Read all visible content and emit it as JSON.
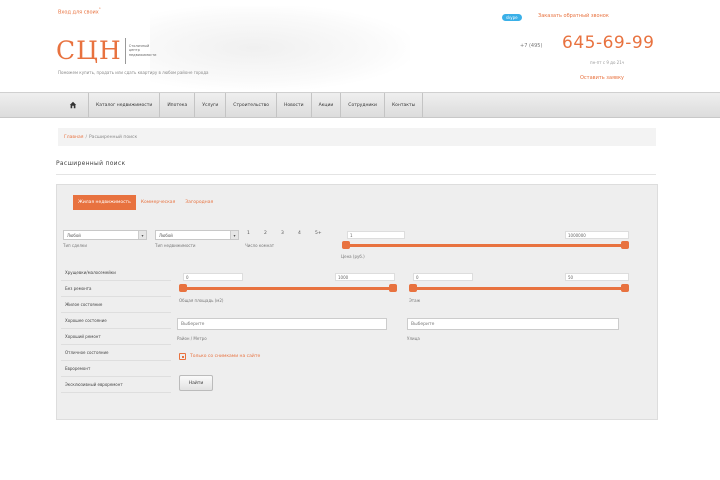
{
  "header": {
    "top_link": "Вход для своих",
    "logo_mark": "СЦН",
    "logo_sub": [
      "Столичный",
      "центр",
      "недвижимости"
    ],
    "tagline": "Поможем купить, продать или сдать квартиру в любом районе города",
    "skype_label": "skype",
    "callback_label": "Заказать обратный звонок",
    "phone_prefix": "+7 (495)",
    "phone": "645-69-99",
    "hours": "пн-пт с 9 до 21ч",
    "request_label": "Оставить заявку"
  },
  "nav": {
    "items": [
      "Каталог недвижимости",
      "Ипотека",
      "Услуги",
      "Строительство",
      "Новости",
      "Акции",
      "Сотрудники",
      "Контакты"
    ]
  },
  "breadcrumb": {
    "home": "Главная",
    "separator": "/",
    "current": "Расширенный поиск"
  },
  "page_title": "Расширенный поиск",
  "search": {
    "tabs": {
      "active": "Жилая недвижимость",
      "items": [
        "Коммерческая",
        "Загородная"
      ]
    },
    "deal_select": {
      "value": "Любой",
      "label": "Тип сделки"
    },
    "type_select": {
      "value": "Любой",
      "label": "Тип недвижимости"
    },
    "rooms": {
      "options": [
        "1",
        "2",
        "3",
        "4",
        "5+"
      ],
      "label": "Число комнат"
    },
    "price": {
      "min": "1",
      "max": "1000000",
      "label": "Цена (руб.)"
    },
    "side_items": [
      "Хрущевки/малосемейки",
      "Без ремонта",
      "Жилое состояние",
      "Хорошее состояние",
      "Хороший ремонт",
      "Отличное состояние",
      "Евроремонт",
      "Эксклюзивный евроремонт"
    ],
    "area": {
      "min": "0",
      "max": "1000",
      "label": "Общая площадь (м2)"
    },
    "floor": {
      "min": "0",
      "max": "50",
      "label": "Этаж"
    },
    "district": {
      "placeholder": "Выберите",
      "label": "Район / Метро"
    },
    "street": {
      "placeholder": "Выберите",
      "label": "Улица"
    },
    "photo_only_label": "Только со снимками на сайте",
    "find_label": "Найти"
  },
  "colors": {
    "accent": "#e8723f",
    "nav_bg": "#e4e4e4",
    "panel_bg": "#eeeeee"
  }
}
